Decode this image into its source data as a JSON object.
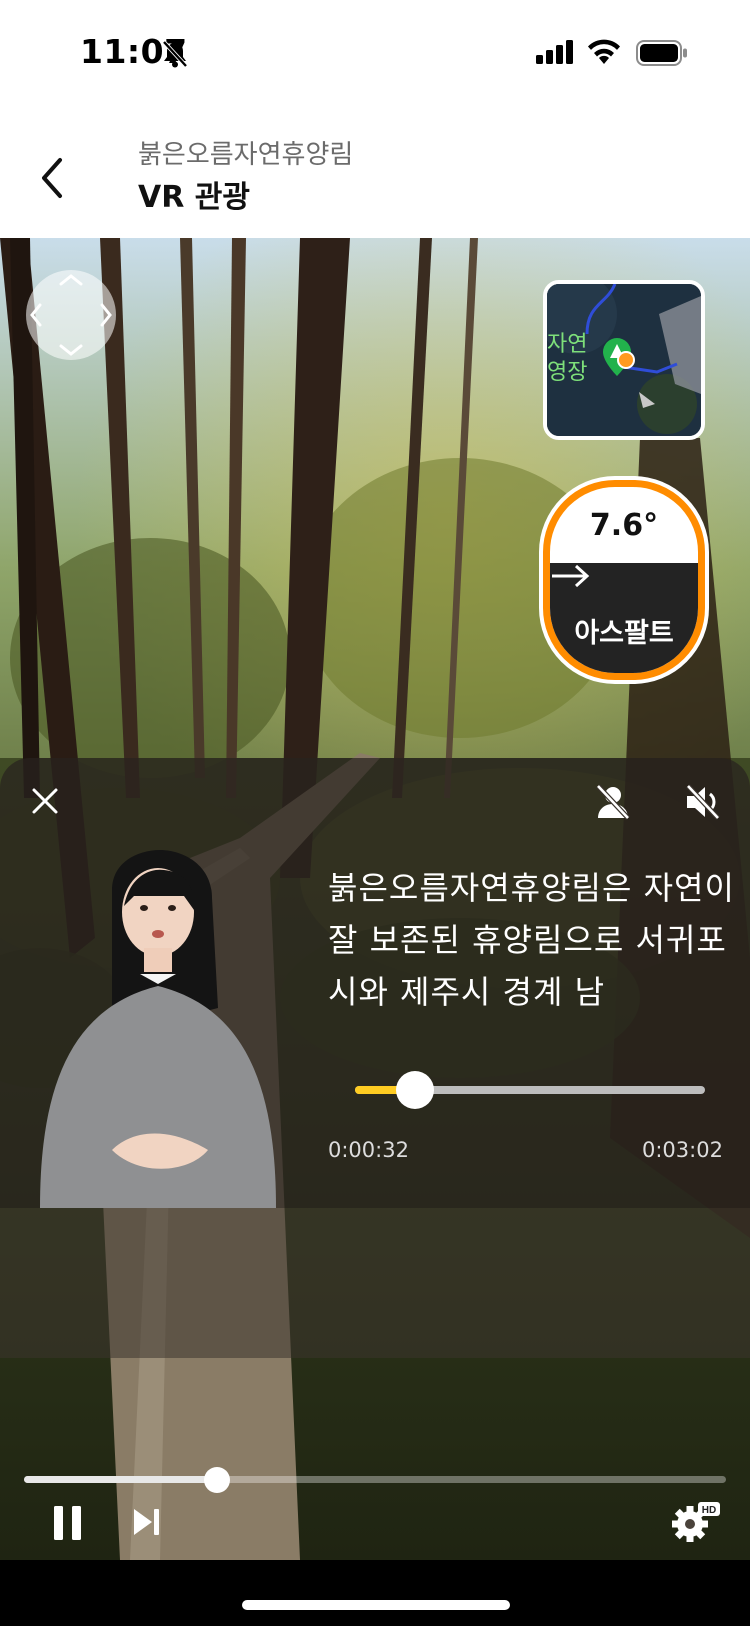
{
  "status_bar": {
    "time": "11:07",
    "bell_icon": "bell-slash-icon",
    "signal_icon": "cellular-signal-icon",
    "wifi_icon": "wifi-icon",
    "battery_icon": "battery-icon"
  },
  "header": {
    "back_icon": "chevron-left-icon",
    "subtitle": "붉은오름자연휴양림",
    "title": "VR 관광"
  },
  "vr_scene": {
    "nav_pad_icon": "direction-pad-icon",
    "minimap": {
      "label_line1": "자연",
      "label_line2": "영장",
      "marker_icon": "campsite-marker-icon"
    },
    "slope_badge": {
      "angle": "7.6°",
      "arrow_icon": "arrow-right-icon",
      "surface": "아스팔트",
      "accent_color": "#ff8c00"
    }
  },
  "guide_panel": {
    "close_icon": "close-icon",
    "avatar_mute_icon": "person-off-icon",
    "sound_mute_icon": "volume-mute-icon",
    "presenter_icon": "presenter-avatar",
    "caption": "붉은오름자연휴양림은 자연이 잘 보존된 휴양림으로 서귀포시와 제주시 경계 남",
    "current_time": "0:00:32",
    "total_time": "0:03:02",
    "progress_fraction": 0.17,
    "accent_color": "#ffcc22"
  },
  "player": {
    "progress_fraction": 0.26,
    "pause_icon": "pause-icon",
    "next_icon": "skip-next-icon",
    "settings_icon": "settings-hd-icon",
    "settings_badge": "HD"
  }
}
